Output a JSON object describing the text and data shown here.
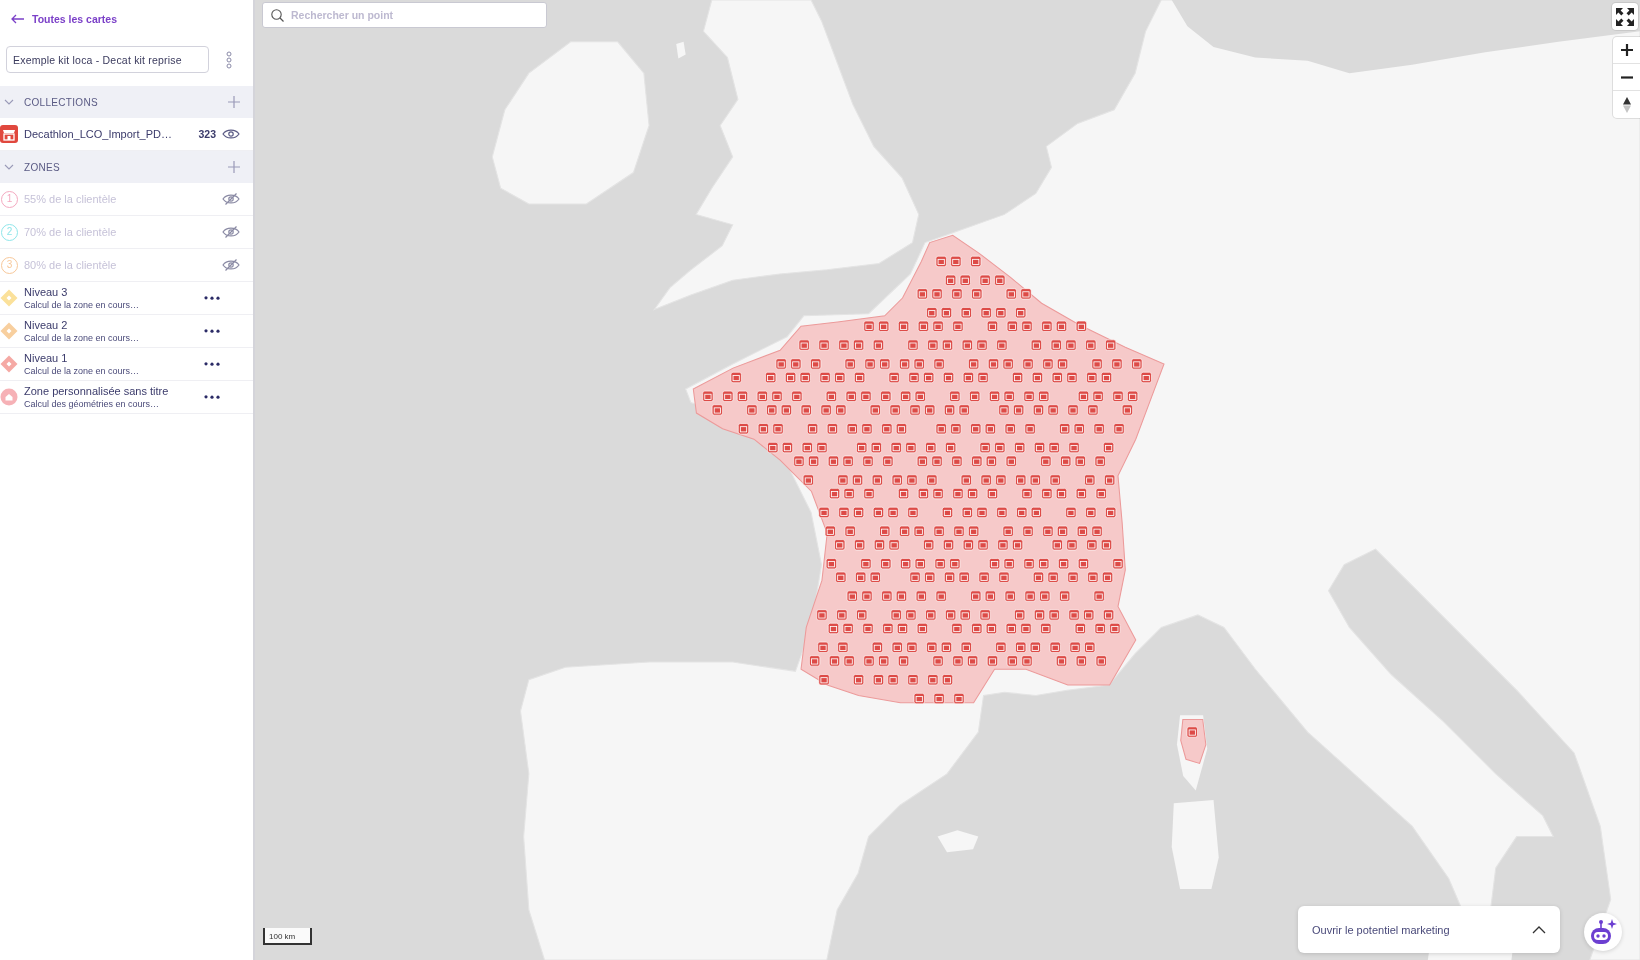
{
  "back_link": {
    "label": "Toutes les cartes"
  },
  "map_title": {
    "value": "Exemple kit loca - Decat kit reprise"
  },
  "sections": [
    {
      "title": "COLLECTIONS",
      "expanded": true,
      "items": [
        {
          "kind": "collection",
          "label": "Decathlon_LCO_Import_PD…",
          "count": "323",
          "visible": true
        }
      ]
    },
    {
      "title": "ZONES",
      "expanded": true,
      "items": [
        {
          "kind": "threshold",
          "badge": "1",
          "label": "55% de la clientèle",
          "color": "#f4a9c0",
          "visible": false
        },
        {
          "kind": "threshold",
          "badge": "2",
          "label": "70% de la clientèle",
          "color": "#8fe6ea",
          "visible": false
        },
        {
          "kind": "threshold",
          "badge": "3",
          "label": "80% de la clientèle",
          "color": "#f7c89a",
          "visible": false
        },
        {
          "kind": "level",
          "label": "Niveau 3",
          "status": "Calcul de la zone en cours…",
          "color": "#fbe19a"
        },
        {
          "kind": "level",
          "label": "Niveau 2",
          "status": "Calcul de la zone en cours…",
          "color": "#f8cf9e"
        },
        {
          "kind": "level",
          "label": "Niveau 1",
          "status": "Calcul de la zone en cours…",
          "color": "#f5a9a4"
        },
        {
          "kind": "custom",
          "label": "Zone personnalisée sans titre",
          "status": "Calcul des géométries en cours…",
          "color": "#f6b1b6"
        }
      ]
    }
  ],
  "search": {
    "placeholder": "Rechercher un point"
  },
  "scale": {
    "label": "100 km"
  },
  "marketing_panel": {
    "label": "Ouvrir le potentiel marketing",
    "expanded": false
  }
}
